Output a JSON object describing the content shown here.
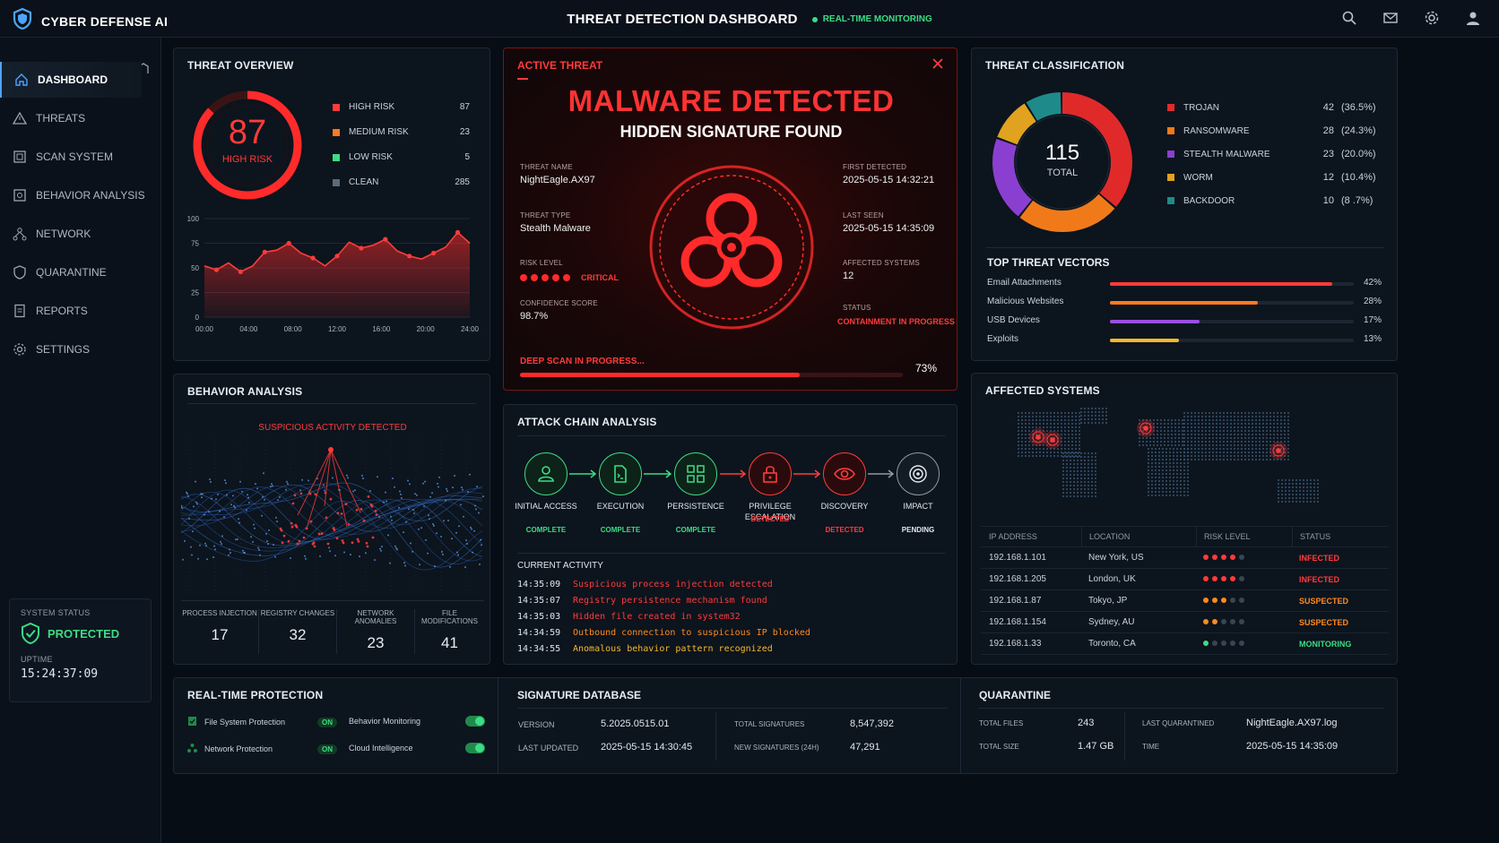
{
  "app": {
    "name": "CYBER DEFENSE AI",
    "title": "THREAT DETECTION DASHBOARD",
    "live_label": "REAL-TIME MONITORING"
  },
  "sidebar": {
    "items": [
      {
        "label": "DASHBOARD",
        "icon": "home-icon"
      },
      {
        "label": "THREATS",
        "icon": "warning-icon"
      },
      {
        "label": "SCAN SYSTEM",
        "icon": "scan-icon"
      },
      {
        "label": "BEHAVIOR ANALYSIS",
        "icon": "behavior-icon"
      },
      {
        "label": "NETWORK",
        "icon": "network-icon"
      },
      {
        "label": "QUARANTINE",
        "icon": "shield-icon"
      },
      {
        "label": "REPORTS",
        "icon": "report-icon"
      },
      {
        "label": "SETTINGS",
        "icon": "gear-icon"
      }
    ],
    "status": {
      "label": "SYSTEM STATUS",
      "value": "PROTECTED",
      "uptime_label": "UPTIME",
      "uptime": "15:24:37:09"
    }
  },
  "overview": {
    "title": "THREAT OVERVIEW",
    "score": "87",
    "score_label": "HIGH RISK",
    "legend": [
      {
        "label": "HIGH RISK",
        "value": "87",
        "color": "#ff3b3b"
      },
      {
        "label": "MEDIUM RISK",
        "value": "23",
        "color": "#ff7a1f"
      },
      {
        "label": "LOW RISK",
        "value": "5",
        "color": "#3ddc84"
      },
      {
        "label": "CLEAN",
        "value": "285",
        "color": "#5a6b7c"
      }
    ]
  },
  "chart_data": {
    "type": "area",
    "x": [
      "00:00",
      "01:00",
      "02:00",
      "03:00",
      "04:00",
      "05:00",
      "06:00",
      "07:00",
      "08:00",
      "09:00",
      "10:00",
      "11:00",
      "12:00",
      "13:00",
      "14:00",
      "15:00",
      "16:00",
      "17:00",
      "18:00",
      "19:00",
      "20:00",
      "21:00",
      "22:00",
      "23:00",
      "24:00"
    ],
    "xticks": [
      "00:00",
      "04:00",
      "08:00",
      "12:00",
      "16:00",
      "20:00",
      "24:00"
    ],
    "yticks": [
      "0",
      "25",
      "50",
      "75",
      "100"
    ],
    "ylim": [
      0,
      100
    ],
    "values": [
      52,
      48,
      55,
      46,
      52,
      66,
      68,
      75,
      65,
      60,
      52,
      62,
      76,
      70,
      73,
      79,
      67,
      62,
      59,
      65,
      71,
      86,
      75,
      0,
      0
    ],
    "values_trimmed": [
      52,
      48,
      55,
      46,
      52,
      66,
      68,
      75,
      65,
      60,
      52,
      62,
      76,
      70,
      73,
      79,
      67,
      62,
      59,
      65,
      71,
      86,
      75
    ],
    "color": "#ff3b3b"
  },
  "active": {
    "title": "ACTIVE THREAT",
    "headline": "MALWARE DETECTED",
    "subhead": "HIDDEN SIGNATURE FOUND",
    "name_label": "THREAT NAME",
    "name": "NightEagle.AX97",
    "type_label": "THREAT TYPE",
    "type": "Stealth Malware",
    "risk_label": "RISK LEVEL",
    "risk": "CRITICAL",
    "conf_label": "CONFIDENCE SCORE",
    "conf": "98.7%",
    "first_label": "FIRST DETECTED",
    "first": "2025-05-15 14:32:21",
    "last_label": "LAST SEEN",
    "last": "2025-05-15 14:35:09",
    "affected_label": "AFFECTED SYSTEMS",
    "affected": "12",
    "status_label": "STATUS",
    "status": "CONTAINMENT IN PROGRESS",
    "scan_label": "DEEP SCAN IN PROGRESS...",
    "scan_pct": "73%",
    "scan_fraction": 0.73
  },
  "classification": {
    "title": "THREAT CLASSIFICATION",
    "total": "115",
    "total_label": "TOTAL",
    "items": [
      {
        "label": "TROJAN",
        "count": "42",
        "pct": "(36.5%)",
        "color": "#e02a2a",
        "value": 42
      },
      {
        "label": "RANSOMWARE",
        "count": "28",
        "pct": "(24.3%)",
        "color": "#f07a1a",
        "value": 28
      },
      {
        "label": "STEALTH MALWARE",
        "count": "23",
        "pct": "(20.0%)",
        "color": "#8b3fd0",
        "value": 23
      },
      {
        "label": "WORM",
        "count": "12",
        "pct": "(10.4%)",
        "color": "#e0a21f",
        "value": 12
      },
      {
        "label": "BACKDOOR",
        "count": "10",
        "pct": "(8 .7%)",
        "color": "#1f8a8a",
        "value": 10
      }
    ]
  },
  "vectors": {
    "title": "TOP THREAT VECTORS",
    "items": [
      {
        "label": "Email Attachments",
        "pct": "42%",
        "value": 0.42,
        "color": "#ff3b3b"
      },
      {
        "label": "Malicious Websites",
        "pct": "28%",
        "value": 0.28,
        "color": "#ff7a1f"
      },
      {
        "label": "USB Devices",
        "pct": "17%",
        "value": 0.17,
        "color": "#9a4fe0"
      },
      {
        "label": "Exploits",
        "pct": "13%",
        "value": 0.13,
        "color": "#f5b82e"
      }
    ]
  },
  "behavior": {
    "title": "BEHAVIOR ANALYSIS",
    "alert": "SUSPICIOUS ACTIVITY DETECTED",
    "stats": [
      {
        "label": "PROCESS INJECTION",
        "value": "17"
      },
      {
        "label": "REGISTRY CHANGES",
        "value": "32"
      },
      {
        "label": "NETWORK ANOMALIES",
        "value": "23"
      },
      {
        "label": "FILE MODIFICATIONS",
        "value": "41"
      }
    ]
  },
  "chain": {
    "title": "ATTACK CHAIN ANALYSIS",
    "nodes": [
      {
        "name": "INITIAL ACCESS",
        "status": "COMPLETE",
        "icon": "user-icon"
      },
      {
        "name": "EXECUTION",
        "status": "COMPLETE",
        "icon": "file-icon"
      },
      {
        "name": "PERSISTENCE",
        "status": "COMPLETE",
        "icon": "grid-icon"
      },
      {
        "name": "PRIVILEGE ESCALATION",
        "status": "DETECTED",
        "icon": "lock-icon"
      },
      {
        "name": "DISCOVERY",
        "status": "DETECTED",
        "icon": "eye-icon"
      },
      {
        "name": "IMPACT",
        "status": "PENDING",
        "icon": "target-icon"
      }
    ],
    "activity_title": "CURRENT ACTIVITY",
    "activity": [
      {
        "time": "14:35:09",
        "text": "Suspicious process injection detected"
      },
      {
        "time": "14:35:07",
        "text": "Registry persistence mechanism found"
      },
      {
        "time": "14:35:03",
        "text": "Hidden file created in system32"
      },
      {
        "time": "14:34:59",
        "text": "Outbound connection to suspicious IP blocked"
      },
      {
        "time": "14:34:55",
        "text": "Anomalous behavior pattern recognized"
      }
    ]
  },
  "affected": {
    "title": "AFFECTED SYSTEMS",
    "headers": [
      "IP ADDRESS",
      "LOCATION",
      "RISK LEVEL",
      "STATUS"
    ],
    "rows": [
      {
        "ip": "192.168.1.101",
        "loc": "New York, US",
        "risk": 4,
        "status": "INFECTED"
      },
      {
        "ip": "192.168.1.205",
        "loc": "London, UK",
        "risk": 4,
        "status": "INFECTED"
      },
      {
        "ip": "192.168.1.87",
        "loc": "Tokyo, JP",
        "risk": 3,
        "status": "SUSPECTED"
      },
      {
        "ip": "192.168.1.154",
        "loc": "Sydney, AU",
        "risk": 2,
        "status": "SUSPECTED"
      },
      {
        "ip": "192.168.1.33",
        "loc": "Toronto, CA",
        "risk": 1,
        "status": "MONITORING"
      }
    ]
  },
  "protection": {
    "title": "REAL-TIME PROTECTION",
    "items": [
      {
        "label": "File System Protection",
        "state": "ON"
      },
      {
        "label": "Behavior Monitoring",
        "state": "on"
      },
      {
        "label": "Network Protection",
        "state": "ON"
      },
      {
        "label": "Cloud Intelligence",
        "state": "on"
      }
    ]
  },
  "signature": {
    "title": "SIGNATURE DATABASE",
    "version_label": "VERSION",
    "version": "5.2025.0515.01",
    "updated_label": "LAST UPDATED",
    "updated": "2025-05-15 14:30:45",
    "total_label": "TOTAL SIGNATURES",
    "total": "8,547,392",
    "new_label": "NEW SIGNATURES (24H)",
    "new": "47,291"
  },
  "quarantine": {
    "title": "QUARANTINE",
    "files_label": "TOTAL FILES",
    "files": "243",
    "size_label": "TOTAL SIZE",
    "size": "1.47 GB",
    "last_label": "LAST QUARANTINED",
    "last": "NightEagle.AX97.log",
    "time_label": "TIME",
    "time": "2025-05-15 14:35:09"
  }
}
